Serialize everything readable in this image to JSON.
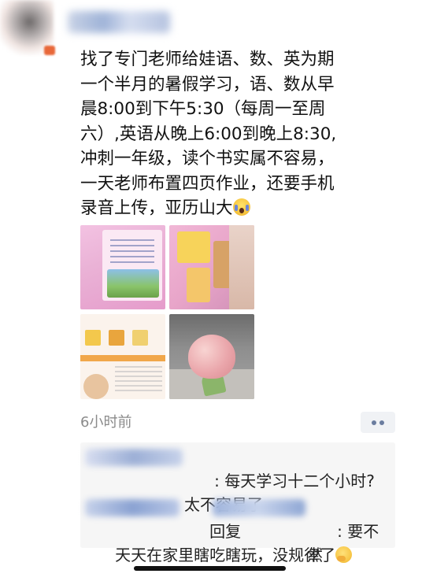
{
  "post": {
    "author_name": "",
    "text": "找了专门老师给娃语、数、英为期\n一个半月的暑假学习，语、数从早\n晨8:00到下午5:30（每周一至周\n六）,英语从晚上6:00到晚上8:30,\n冲刺一年级，读个书实属不容易，\n一天老师布置四页作业，还要手机\n录音上传，亚历山大",
    "emoji": "scream-face",
    "images": [
      {
        "name": "english-workbook-page"
      },
      {
        "name": "pink-picture-cards"
      },
      {
        "name": "vocabulary-workbook-page"
      },
      {
        "name": "peach-toy-photo"
      }
    ],
    "time": "6小时前"
  },
  "comments": [
    {
      "author": "",
      "text": ": 每天学习十二个小时?\n太不容易了"
    },
    {
      "author": "",
      "reply_word": "回复",
      "reply_to": "",
      "text": ": 要不然\n天天在家里瞎吃瞎玩，没规律了",
      "emoji": "thinking-face"
    }
  ],
  "colors": {
    "text": "#111111",
    "time": "#8a8a8a",
    "comment_bg": "#f6f6f6",
    "more_dots": "#6b7d9f"
  }
}
